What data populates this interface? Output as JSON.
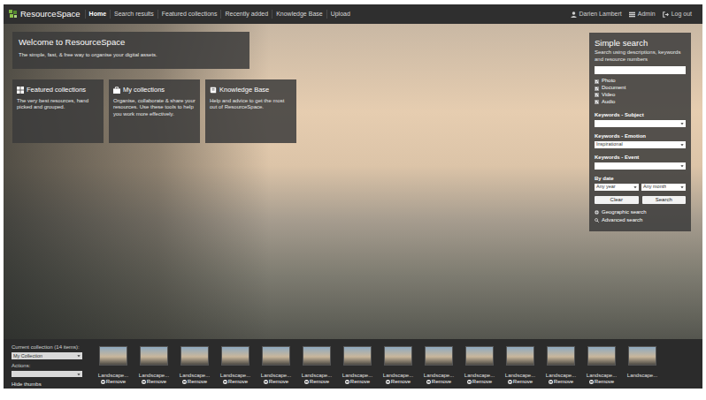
{
  "nav": {
    "logo": "ResourceSpace",
    "links": [
      {
        "label": "Home",
        "selected": true
      },
      {
        "label": "Search results",
        "selected": false
      },
      {
        "label": "Featured collections",
        "selected": false
      },
      {
        "label": "Recently added",
        "selected": false
      },
      {
        "label": "Knowledge Base",
        "selected": false
      },
      {
        "label": "Upload",
        "selected": false
      }
    ],
    "user": "Darien Lambert",
    "admin": "Admin",
    "logout": "Log out"
  },
  "welcome": {
    "title": "Welcome to ResourceSpace",
    "subtitle": "The simple, fast, & free way to organise your digital assets."
  },
  "tiles": [
    {
      "title": "Featured collections",
      "description": "The very best resources, hand picked and grouped."
    },
    {
      "title": "My collections",
      "description": "Organise, collaborate & share your resources. Use these tools to help you work more effectively."
    },
    {
      "title": "Knowledge Base",
      "description": "Help and advice to get the most out of ResourceSpace."
    }
  ],
  "search": {
    "title": "Simple search",
    "description": "Search using descriptions, keywords and resource numbers",
    "types": [
      {
        "label": "Photo",
        "checked": true
      },
      {
        "label": "Document",
        "checked": true
      },
      {
        "label": "Video",
        "checked": true
      },
      {
        "label": "Audio",
        "checked": true
      }
    ],
    "fields": [
      {
        "label": "Keywords - Subject",
        "value": ""
      },
      {
        "label": "Keywords - Emotion",
        "value": "Inspirational"
      },
      {
        "label": "Keywords - Event",
        "value": ""
      }
    ],
    "date_label": "By date",
    "year": "Any year",
    "month": "Any month",
    "buttons": [
      "Clear",
      "Search"
    ],
    "links": [
      "Geographic search",
      "Advanced search"
    ]
  },
  "collection": {
    "label": "Current collection (14 items):",
    "selected": "My Collection",
    "actions_label": "Actions:",
    "actions_value": "",
    "hide": "Hide thumbs",
    "items": [
      {
        "label": "Landscape...",
        "action": "Remove"
      },
      {
        "label": "Landscape...",
        "action": "Remove"
      },
      {
        "label": "Landscape...",
        "action": "Remove"
      },
      {
        "label": "Landscape...",
        "action": "Remove"
      },
      {
        "label": "Landscape...",
        "action": "Remove"
      },
      {
        "label": "Landscape...",
        "action": "Remove"
      },
      {
        "label": "Landscape...",
        "action": "Remove"
      },
      {
        "label": "Landscape...",
        "action": "Remove"
      },
      {
        "label": "Landscape...",
        "action": "Remove"
      },
      {
        "label": "Landscape...",
        "action": "Remove"
      },
      {
        "label": "Landscape...",
        "action": "Remove"
      },
      {
        "label": "Landscape...",
        "action": "Remove"
      },
      {
        "label": "Landscape...",
        "action": "Remove"
      },
      {
        "label": "Landscape...",
        "action": ""
      }
    ]
  }
}
